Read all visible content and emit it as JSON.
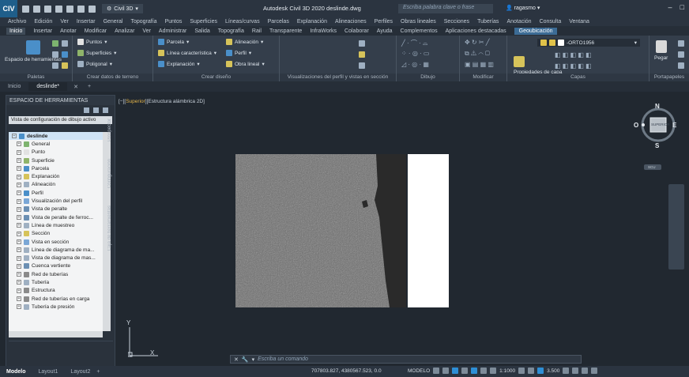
{
  "titlebar": {
    "app_icon": "CIV",
    "workspace": "Civil 3D",
    "window_title": "Autodesk Civil 3D 2020   deslinde.dwg",
    "search_placeholder": "Escriba palabra clave o frase",
    "user": "ragasmo"
  },
  "menubar": [
    "Archivo",
    "Edición",
    "Ver",
    "Insertar",
    "General",
    "Topografía",
    "Puntos",
    "Superficies",
    "Líneas/curvas",
    "Parcelas",
    "Explanación",
    "Alineaciones",
    "Perfiles",
    "Obras lineales",
    "Secciones",
    "Tuberías",
    "Anotación",
    "Consulta",
    "Ventana"
  ],
  "ribbon_tabs": [
    "Inicio",
    "Insertar",
    "Anotar",
    "Modificar",
    "Analizar",
    "Ver",
    "Administrar",
    "Salida",
    "Topografía",
    "Rail",
    "Transparente",
    "InfraWorks",
    "Colaborar",
    "Ayuda",
    "Complementos",
    "Aplicaciones destacadas",
    "Geoubicación"
  ],
  "ribbon": {
    "paletas": {
      "title": "Paletas",
      "big_label": "Espacio de herramientas"
    },
    "crear_datos": {
      "title": "Crear datos de terreno",
      "items": [
        "Puntos",
        "Superficies",
        "Poligonal"
      ]
    },
    "crear_diseno": {
      "title": "Crear diseño",
      "items": [
        "Parcela",
        "Línea característica",
        "Explanación",
        "Alineación",
        "Perfil",
        "Obra lineal"
      ]
    },
    "perfil_vistas": {
      "title": "Visualizaciones del perfil y vistas en sección"
    },
    "dibujo": {
      "title": "Dibujo"
    },
    "modificar": {
      "title": "Modificar"
    },
    "capas": {
      "title": "Capas",
      "layer_name": "-ORTO1956",
      "label": "Propiedades de capa"
    },
    "portapapeles": {
      "title": "Portapapeles",
      "label": "Pegar"
    }
  },
  "doc_tabs": [
    "Inicio",
    "deslinde*"
  ],
  "palette": {
    "title": "ESPACIO DE HERRAMIENTAS",
    "combo": "Vista de configuración de dibujo activo",
    "root": "deslinde",
    "items": [
      "General",
      "Punto",
      "Superficie",
      "Parcela",
      "Explanación",
      "Alineación",
      "Perfil",
      "Visualización del perfil",
      "Vista de peralte",
      "Vista de peralte de ferroc...",
      "Línea de muestreo",
      "Sección",
      "Vista en sección",
      "Línea de diagrama de ma...",
      "Vista de diagrama de mas...",
      "Cuenca vertiente",
      "Red de tuberías",
      "Tubería",
      "Estructura",
      "Red de tuberías en carga",
      "Tubería de presión"
    ],
    "side_tabs": [
      "Prospector",
      "Configuración",
      "Caja de herramientas"
    ]
  },
  "viewport": {
    "label_prefix": "[−][",
    "label_view": "Superior",
    "label_suffix": "][Estructura alámbrica 2D]",
    "ucs_x": "X",
    "ucs_y": "Y",
    "viewcube": {
      "N": "N",
      "S": "S",
      "E": "E",
      "O": "O",
      "face": "SUPERIOR",
      "wcs": "SCU"
    }
  },
  "command": {
    "placeholder": "Escriba un comando"
  },
  "statusbar": {
    "tabs": [
      "Modelo",
      "Layout1",
      "Layout2"
    ],
    "coords": "707803.827, 4380567.523, 0.0",
    "mode": "MODELO",
    "scale": "1:1000",
    "value": "3.500"
  },
  "colors": {
    "accent": "#3c6c96",
    "ortho_sea": "#2a2a2a",
    "ortho_land": "#6b6b6b"
  }
}
